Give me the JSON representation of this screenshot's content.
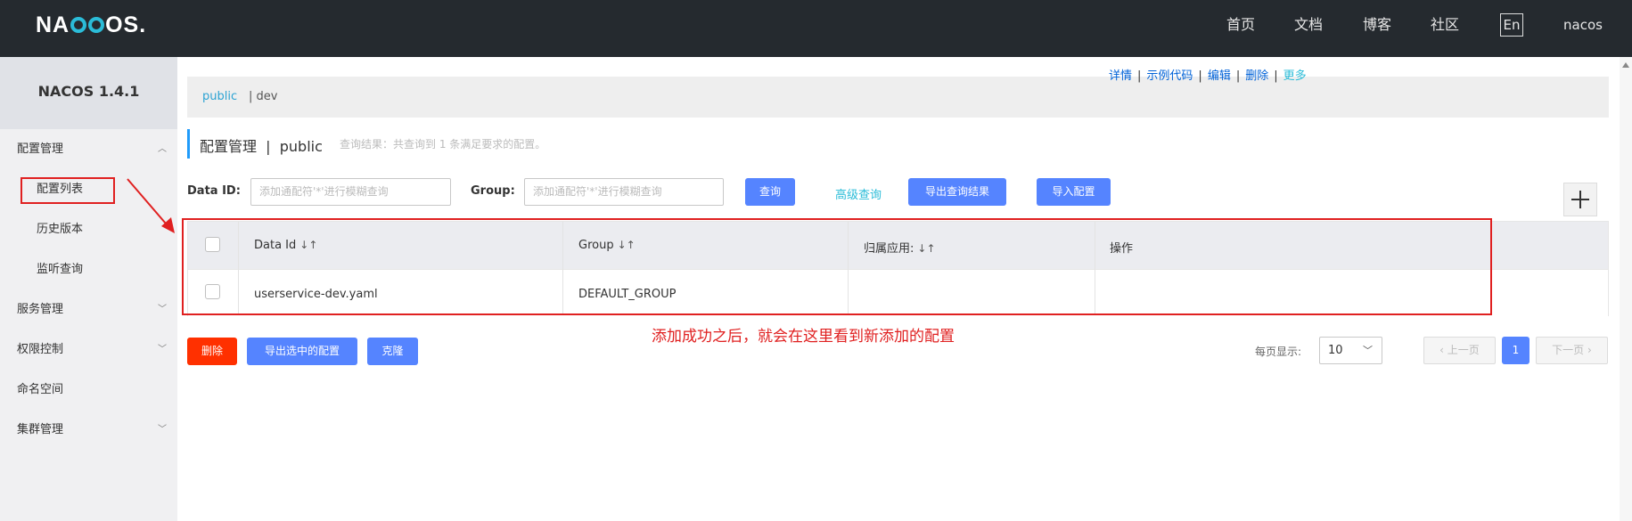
{
  "topbar": {
    "logo_left": "NA",
    "logo_right": "OS",
    "logo_dot": ".",
    "nav": [
      "首页",
      "文档",
      "博客",
      "社区"
    ],
    "lang": "En",
    "user": "nacos"
  },
  "sidebar": {
    "version": "NACOS 1.4.1",
    "items": [
      {
        "label": "配置管理",
        "expanded": true
      },
      {
        "label": "配置列表"
      },
      {
        "label": "历史版本"
      },
      {
        "label": "监听查询"
      },
      {
        "label": "服务管理"
      },
      {
        "label": "权限控制"
      },
      {
        "label": "命名空间"
      },
      {
        "label": "集群管理"
      }
    ],
    "chevron_up": "︿",
    "chevron_down": "﹀"
  },
  "breadcrumb": {
    "active": "public",
    "other": "| dev"
  },
  "title": {
    "main": "配置管理  |  public",
    "hint": "查询结果：共查询到 1 条满足要求的配置。"
  },
  "search": {
    "dataid_label": "Data ID:",
    "dataid_placeholder": "添加通配符'*'进行模糊查询",
    "group_label": "Group:",
    "group_placeholder": "添加通配符'*'进行模糊查询",
    "query_btn": "查询",
    "advanced_link": "高级查询",
    "export_btn": "导出查询结果",
    "import_btn": "导入配置"
  },
  "table": {
    "headers": [
      "Data Id",
      "Group",
      "归属应用:",
      "操作"
    ],
    "sort_glyph": "↓↑",
    "rows": [
      {
        "data_id": "userservice-dev.yaml",
        "group": "DEFAULT_GROUP",
        "app": ""
      }
    ],
    "ops": [
      "详情",
      "示例代码",
      "编辑",
      "删除",
      "更多"
    ],
    "sep": "|"
  },
  "bottom": {
    "delete_btn": "删除",
    "export_selected_btn": "导出选中的配置",
    "clone_btn": "克隆",
    "note": "添加成功之后，就会在这里看到新添加的配置",
    "per_page_label": "每页显示:",
    "per_page_value": "10",
    "prev": "上一页",
    "current_page": "1",
    "next": "下一页"
  },
  "colors": {
    "accent": "#5584ff",
    "danger": "#ff3000",
    "link": "#2bbcd8",
    "annotation": "#e02020"
  }
}
